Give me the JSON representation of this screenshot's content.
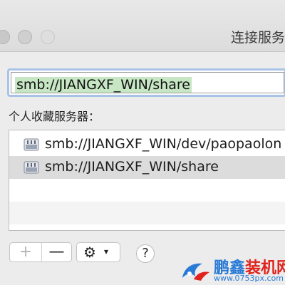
{
  "window": {
    "title": "连接服务",
    "controls": [
      "close",
      "minimize",
      "zoom"
    ]
  },
  "address": {
    "value": "smb://JIANGXF_WIN/share"
  },
  "favorites": {
    "label": "个人收藏服务器：",
    "items": [
      {
        "text": "smb://JIANGXF_WIN/dev/paopaolon",
        "icon": "server-icon",
        "selected": false
      },
      {
        "text": "smb://JIANGXF_WIN/share",
        "icon": "server-icon",
        "selected": true
      }
    ]
  },
  "toolbar": {
    "add_label": "+",
    "remove_label": "—",
    "gear_icon": "⚙",
    "gear_chevron": "▾",
    "help_label": "?"
  },
  "watermark": {
    "name_part1": "鹏鑫",
    "name_part2": "装机网",
    "url": "www.0753px.com"
  },
  "colors": {
    "address_highlight": "#c7e6c4",
    "focus_ring": "#a9c3e7",
    "selected_row": "#dcdcdc",
    "watermark_blue": "#2a7bd6",
    "watermark_red": "#e0231c"
  }
}
